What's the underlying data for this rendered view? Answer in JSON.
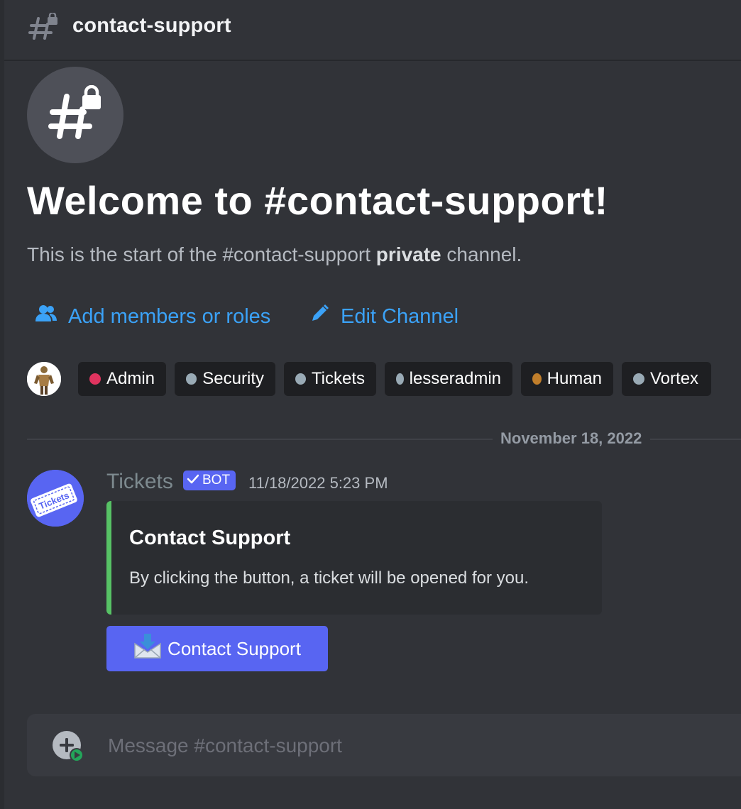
{
  "header": {
    "channel_name": "contact-support",
    "icon": "private-hashtag-icon"
  },
  "welcome": {
    "title": "Welcome to #contact-support!",
    "subtitle_prefix": "This is the start of the #contact-support",
    "subtitle_bold": "private",
    "subtitle_suffix": "channel."
  },
  "actions": {
    "add_members": "Add members or roles",
    "edit_channel": "Edit Channel"
  },
  "roles": [
    {
      "name": "Admin",
      "color": "#e0345f"
    },
    {
      "name": "Security",
      "color": "#99aab5"
    },
    {
      "name": "Tickets",
      "color": "#99aab5"
    },
    {
      "name": "lesseradmin",
      "color": "#99aab5"
    },
    {
      "name": "Human",
      "color": "#c07e2b"
    },
    {
      "name": "Vortex",
      "color": "#99aab5"
    }
  ],
  "divider": {
    "date": "November 18, 2022"
  },
  "message": {
    "author": "Tickets",
    "badge": "BOT",
    "timestamp": "11/18/2022 5:23 PM",
    "embed": {
      "title": "Contact Support",
      "description": "By clicking the button, a ticket will be opened for you.",
      "accent_color": "#57c265"
    },
    "button_label": "Contact Support",
    "button_icon": "inbox-tray-icon"
  },
  "composer": {
    "placeholder": "Message #contact-support"
  },
  "colors": {
    "background": "#313338",
    "link": "#3ba2f7",
    "blurple": "#5865f2"
  }
}
